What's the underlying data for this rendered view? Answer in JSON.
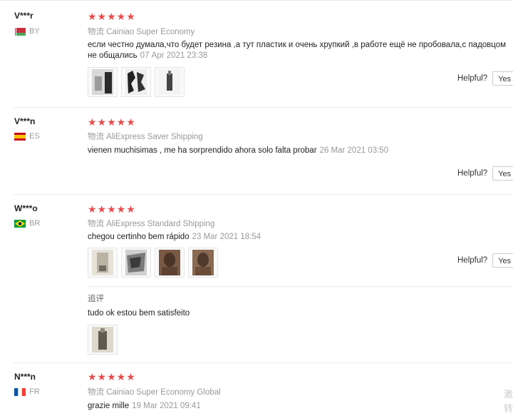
{
  "reviews": [
    {
      "user": "V***r",
      "country": "BY",
      "flag_colors": [
        "#c8313e",
        "#4aa657"
      ],
      "stars": "★★★★★",
      "shipping_prefix": "物流",
      "shipping": "Cainiao Super Economy",
      "text": "если честно думала,что будет резина ,а тут пластик и очень хрупкий ,в работе ещё не пробовала,с падовцом не общались",
      "date": "07 Apr 2021 23:38",
      "photos": [
        "photo-1",
        "photo-2",
        "photo-3"
      ],
      "helpful_label": "Helpful?",
      "yes_label": "Yes"
    },
    {
      "user": "V***n",
      "country": "ES",
      "flag_colors": [
        "#c60b1e",
        "#ffc400"
      ],
      "stars": "★★★★★",
      "shipping_prefix": "物流",
      "shipping": "AliExpress Saver Shipping",
      "text": "vienen muchisimas , me ha sorprendido ahora solo falta probar",
      "date": "26 Mar 2021 03:50",
      "helpful_label": "Helpful?",
      "yes_label": "Yes"
    },
    {
      "user": "W***o",
      "country": "BR",
      "flag_colors": [
        "#009c3b",
        "#ffdf00"
      ],
      "stars": "★★★★★",
      "shipping_prefix": "物流",
      "shipping": "AliExpress Standard Shipping",
      "text": "chegou certinho bem rápido",
      "date": "23 Mar 2021 18:54",
      "photos": [
        "photo-1",
        "photo-2",
        "photo-3",
        "photo-4"
      ],
      "helpful_label": "Helpful?",
      "yes_label": "Yes",
      "additional_label": "追评",
      "additional_text": "tudo ok estou bem satisfeito"
    },
    {
      "user": "N***n",
      "country": "FR",
      "flag_colors": [
        "#0055a4",
        "#ef4135"
      ],
      "stars": "★★★★★",
      "shipping_prefix": "物流",
      "shipping": "Cainiao Super Economy Global",
      "text": "grazie mille",
      "date": "19 Mar 2021 09:41"
    }
  ],
  "watermark": "激活\n转"
}
